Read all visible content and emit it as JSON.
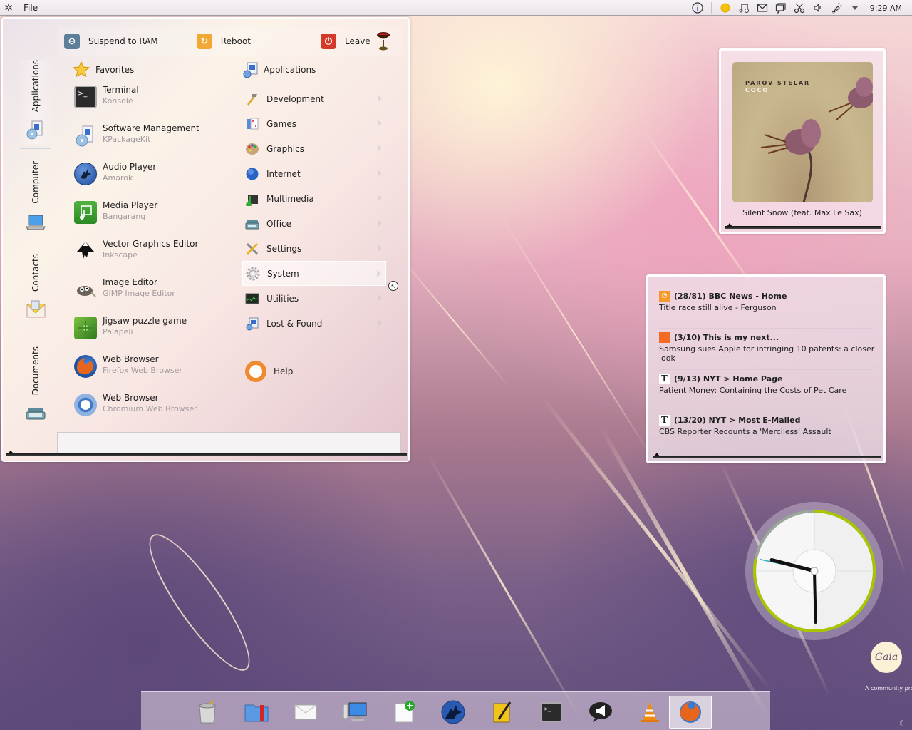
{
  "top_panel": {
    "kicker_icon": "kde-gear-icon",
    "menu": [
      "File"
    ],
    "tray_icons": [
      "info-icon",
      "klipper-sun-icon",
      "music-note-icon",
      "mail-icon",
      "chat-icon",
      "scissors-icon",
      "volume-icon",
      "network-plug-icon",
      "expand-arrow-icon"
    ],
    "time": "9:29 AM"
  },
  "launcher": {
    "session": [
      {
        "label": "Suspend to RAM",
        "icon": "suspend-icon",
        "color": "#5d7f97"
      },
      {
        "label": "Reboot",
        "icon": "reboot-icon",
        "color": "#f2a834"
      },
      {
        "label": "Leave",
        "icon": "leave-icon",
        "color": "#d23a2c"
      }
    ],
    "side_tabs": [
      {
        "label": "Applications",
        "icon": "software-package-icon"
      },
      {
        "label": "Computer",
        "icon": "laptop-icon"
      },
      {
        "label": "Contacts",
        "icon": "address-book-icon"
      },
      {
        "label": "Documents",
        "icon": "typewriter-icon"
      }
    ],
    "favorites_title": "Favorites",
    "favorites": [
      {
        "name": "Terminal",
        "sub": "Konsole",
        "icon": "terminal-icon"
      },
      {
        "name": "Software Management",
        "sub": "KPackageKit",
        "icon": "software-package-icon"
      },
      {
        "name": "Audio Player",
        "sub": "Amarok",
        "icon": "amarok-wolf-icon"
      },
      {
        "name": "Media Player",
        "sub": "Bangarang",
        "icon": "media-film-icon"
      },
      {
        "name": "Vector Graphics Editor",
        "sub": "Inkscape",
        "icon": "inkscape-icon"
      },
      {
        "name": "Image Editor",
        "sub": "GIMP Image Editor",
        "icon": "gimp-icon"
      },
      {
        "name": "Jigsaw puzzle game",
        "sub": "Palapeli",
        "icon": "puzzle-icon"
      },
      {
        "name": "Web Browser",
        "sub": "Firefox Web Browser",
        "icon": "firefox-icon"
      },
      {
        "name": "Web Browser",
        "sub": "Chromium Web Browser",
        "icon": "chromium-icon"
      }
    ],
    "applications_title": "Applications",
    "categories": [
      {
        "label": "Development",
        "icon": "hammer-icon"
      },
      {
        "label": "Games",
        "icon": "cards-icon"
      },
      {
        "label": "Graphics",
        "icon": "palette-icon"
      },
      {
        "label": "Internet",
        "icon": "globe-icon"
      },
      {
        "label": "Multimedia",
        "icon": "clapper-icon"
      },
      {
        "label": "Office",
        "icon": "typewriter-icon"
      },
      {
        "label": "Settings",
        "icon": "tools-icon"
      },
      {
        "label": "System",
        "icon": "gear-icon"
      },
      {
        "label": "Utilities",
        "icon": "monitor-graph-icon"
      },
      {
        "label": "Lost & Found",
        "icon": "lost-found-icon"
      }
    ],
    "hovered_category": "System",
    "help_label": "Help",
    "search_value": ""
  },
  "now_playing": {
    "album_artist": "PAROV STELAR",
    "album_title": "COCO",
    "track": "Silent Snow (feat. Max Le Sax)"
  },
  "news": [
    {
      "feed": "(28/81) BBC News - Home",
      "headline": "Title race still alive - Ferguson",
      "icon": "rss-icon"
    },
    {
      "feed": "(3/10) This is my next...",
      "headline": "Samsung sues Apple for infringing 10 patents: a closer look",
      "icon": "orange-square-icon"
    },
    {
      "feed": "(9/13) NYT > Home Page",
      "headline": "Patient Money: Containing the Costs of Pet Care",
      "icon": "nyt-icon"
    },
    {
      "feed": "(13/20) NYT > Most E-Mailed",
      "headline": "CBS Reporter Recounts a 'Merciless' Assault",
      "icon": "nyt-icon"
    }
  ],
  "clock": {
    "hours": 9,
    "minutes": 29,
    "seconds": 47,
    "accent": "#a8c500"
  },
  "branding": {
    "logo_text": "Gaia",
    "tagline": "A community proj"
  },
  "dock": [
    {
      "name": "Trash",
      "icon": "trash-icon"
    },
    {
      "name": "File Manager",
      "icon": "folder-bookmark-icon"
    },
    {
      "name": "Mail",
      "icon": "mail-icon"
    },
    {
      "name": "System Settings",
      "icon": "computer-icon"
    },
    {
      "name": "New Note",
      "icon": "new-note-icon"
    },
    {
      "name": "Amarok",
      "icon": "amarok-wolf-icon"
    },
    {
      "name": "Notes",
      "icon": "notebook-pen-icon"
    },
    {
      "name": "Terminal",
      "icon": "terminal-icon"
    },
    {
      "name": "Choqok",
      "icon": "megaphone-bubble-icon"
    },
    {
      "name": "VLC",
      "icon": "vlc-cone-icon"
    },
    {
      "name": "Firefox",
      "icon": "firefox-icon",
      "active": true
    }
  ]
}
